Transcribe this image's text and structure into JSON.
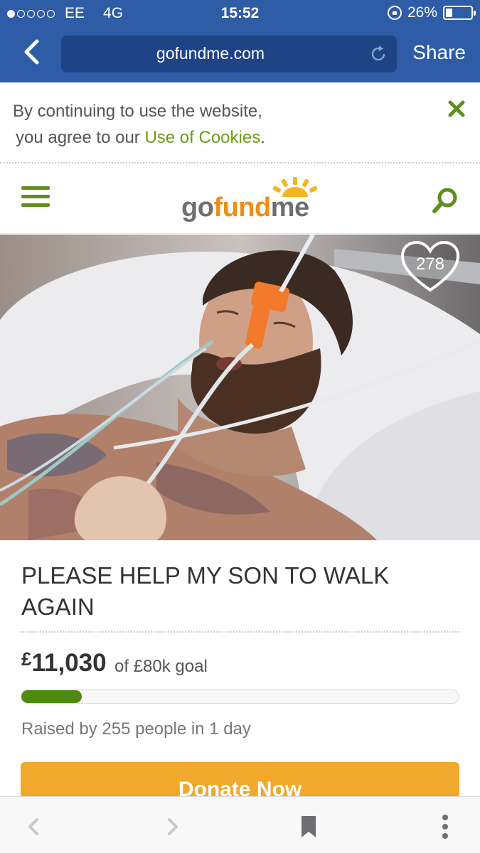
{
  "status_bar": {
    "carrier": "EE",
    "network": "4G",
    "time": "15:52",
    "battery_text": "26%",
    "battery_level": 0.26,
    "signal_bars_filled": 1,
    "signal_bars_total": 5
  },
  "browser": {
    "url": "gofundme.com",
    "share_label": "Share",
    "back_icon": "chevron-left-icon",
    "reload_icon": "reload-icon"
  },
  "cookie_banner": {
    "line1": "By continuing to use the website,",
    "line2_prefix": "you agree to our ",
    "link_text": "Use of Cookies",
    "line2_suffix": ".",
    "close_icon": "close-icon"
  },
  "site_header": {
    "logo_go": "go",
    "logo_fund": "fund",
    "logo_me": "me",
    "menu_icon": "hamburger-menu-icon",
    "search_icon": "search-icon"
  },
  "campaign": {
    "hearts": "278",
    "title": "PLEASE HELP MY SON TO WALK AGAIN",
    "currency": "£",
    "raised_amount": "11,030",
    "goal_text": "of £80k goal",
    "progress_fraction": 0.138,
    "raised_by": "Raised by 255 people in 1 day",
    "donate_label": "Donate Now"
  },
  "colors": {
    "browser_bar": "#2f5ca6",
    "brand_green": "#5e8e1e",
    "brand_orange": "#f08c1a",
    "donate": "#f0a92d"
  }
}
